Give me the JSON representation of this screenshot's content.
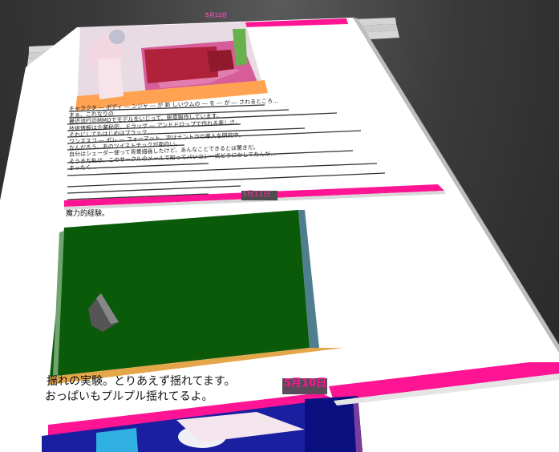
{
  "entries": [
    {
      "date": "5月12日",
      "body_lines": [
        "キャラクタ ― ボディ ― ンジャ ― が 新 しいウムの ― を ― が ― されるところ…",
        "まぁ、これなりの",
        "最近流行のMMDでモデルをいじって、鋭意製作しています。",
        "技術情報は企業秘密、ドラッグ ― アンドドロップで作れる楽しさ。",
        "それにしてもはじめはブラック…",
        "ワンズスコ ― ボレ ― フォーマット、次はナントカの導入を研究中。",
        "なんだろう、あのツイストチックが面白い。",
        "自分はシェーダー使って背景描画したけど、あんなことできるとは驚きだ。",
        "そうまた私は、このサークルのメールで知ってパソコン一式どうにかしてたんだ…",
        "まったく…",
        "魔力的経験。"
      ]
    },
    {
      "date": "5月11日",
      "body_lines": [
        "揺れの実験。とりあえず揺れてます。",
        "おっぱいもプルプル揺れてるよ。"
      ]
    },
    {
      "date": "5月10日"
    }
  ],
  "colors": {
    "accent": "#ff1493",
    "page": "#ffffff",
    "scene_green": "#0a5a0a",
    "scene_blue": "#1a1fa0"
  }
}
